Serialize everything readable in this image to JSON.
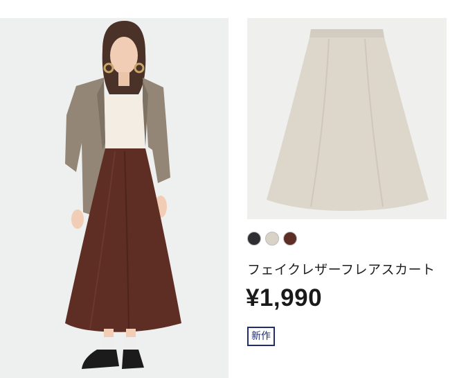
{
  "product": {
    "name": "フェイクレザーフレアスカート",
    "price": "¥1,990",
    "badge": "新作",
    "images": {
      "model": "model-wearing-skirt-photo",
      "flat": "skirt-flat-photo"
    },
    "colors": [
      {
        "name": "black",
        "hex": "#2f2f31"
      },
      {
        "name": "beige",
        "hex": "#d9d2c7"
      },
      {
        "name": "dark-brown",
        "hex": "#5d2e26"
      }
    ]
  }
}
